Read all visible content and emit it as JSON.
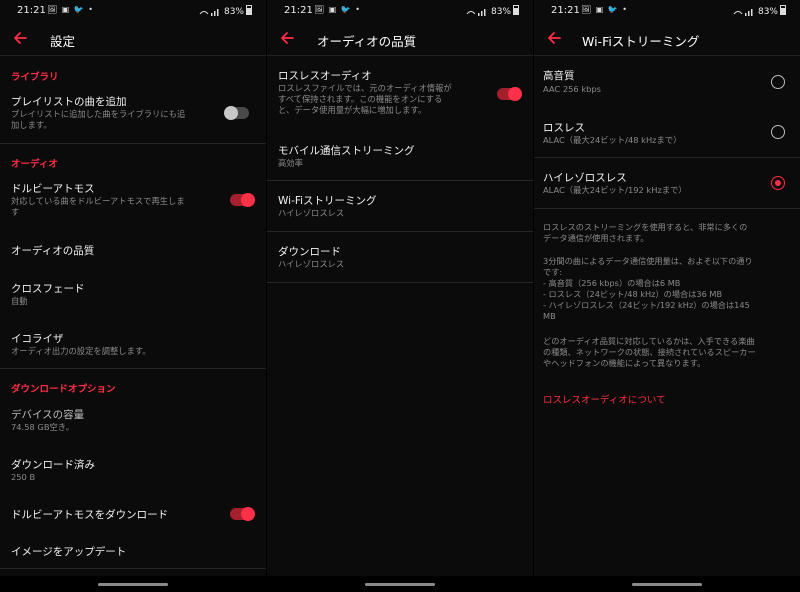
{
  "status_bar": {
    "time": "21:21",
    "notification_icons": "🖼 ▣ 🐦 •",
    "battery": "83%"
  },
  "screen1": {
    "title": "設定",
    "sections": {
      "library": "ライブラリ",
      "audio": "オーディオ",
      "download_options": "ダウンロードオプション"
    },
    "items": {
      "add_playlist_songs": {
        "title": "プレイリストの曲を追加",
        "subtitle_line1": "プレイリストに追加した曲をライブラリにも追",
        "subtitle_line2": "加します。",
        "toggle": "off"
      },
      "dolby_atmos": {
        "title": "ドルビーアトモス",
        "subtitle_line1": "対応している曲をドルビーアトモスで再生しま",
        "subtitle_line2": "す",
        "toggle": "on"
      },
      "audio_quality": {
        "title": "オーディオの品質"
      },
      "crossfade": {
        "title": "クロスフェード",
        "subtitle": "自動"
      },
      "equalizer": {
        "title": "イコライザ",
        "subtitle": "オーディオ出力の設定を調整します。"
      },
      "device_storage": {
        "title": "デバイスの容量",
        "subtitle": "74.58 GB空き。"
      },
      "downloaded": {
        "title": "ダウンロード済み",
        "subtitle": "250 B"
      },
      "download_dolby": {
        "title": "ドルビーアトモスをダウンロード",
        "toggle": "on"
      },
      "update_images": {
        "title": "イメージをアップデート"
      }
    }
  },
  "screen2": {
    "title": "オーディオの品質",
    "items": {
      "lossless": {
        "title": "ロスレスオーディオ",
        "subtitle_line1": "ロスレスファイルでは、元のオーディオ情報が",
        "subtitle_line2": "すべて保持されます。この機能をオンにする",
        "subtitle_line3": "と、データ使用量が大幅に増加します。",
        "toggle": "on"
      },
      "mobile_streaming": {
        "title": "モバイル通信ストリーミング",
        "subtitle": "高効率"
      },
      "wifi_streaming": {
        "title": "Wi-Fiストリーミング",
        "subtitle": "ハイレゾロスレス"
      },
      "download": {
        "title": "ダウンロード",
        "subtitle": "ハイレゾロスレス"
      }
    }
  },
  "screen3": {
    "title": "Wi-Fiストリーミング",
    "options": [
      {
        "title": "高音質",
        "subtitle": "AAC 256 kbps",
        "selected": false
      },
      {
        "title": "ロスレス",
        "subtitle": "ALAC（最大24ビット/48 kHzまで）",
        "selected": false
      },
      {
        "title": "ハイレゾロスレス",
        "subtitle": "ALAC（最大24ビット/192 kHzまで）",
        "selected": true
      }
    ],
    "info_para1_line1": "ロスレスのストリーミングを使用すると、非常に多くの",
    "info_para1_line2": "データ通信が使用されます。",
    "info_para2_line1": "3分間の曲によるデータ通信使用量は、およそ以下の通り",
    "info_para2_line2": "です:",
    "info_para2_line3": "- 高音質（256 kbps）の場合は6 MB",
    "info_para2_line4": "- ロスレス（24ビット/48 kHz）の場合は36 MB",
    "info_para2_line5": "- ハイレゾロスレス（24ビット/192 kHz）の場合は145",
    "info_para2_line6": "MB",
    "info_para3_line1": "どのオーディオ品質に対応しているかは、入手できる楽曲",
    "info_para3_line2": "の種類、ネットワークの状態、接続されているスピーカー",
    "info_para3_line3": "やヘッドフォンの機能によって異なります。",
    "about_link": "ロスレスオーディオについて"
  },
  "colors": {
    "accent": "#ff2d46",
    "background": "#0b0b0b",
    "secondary_text": "#8a8a8a"
  }
}
